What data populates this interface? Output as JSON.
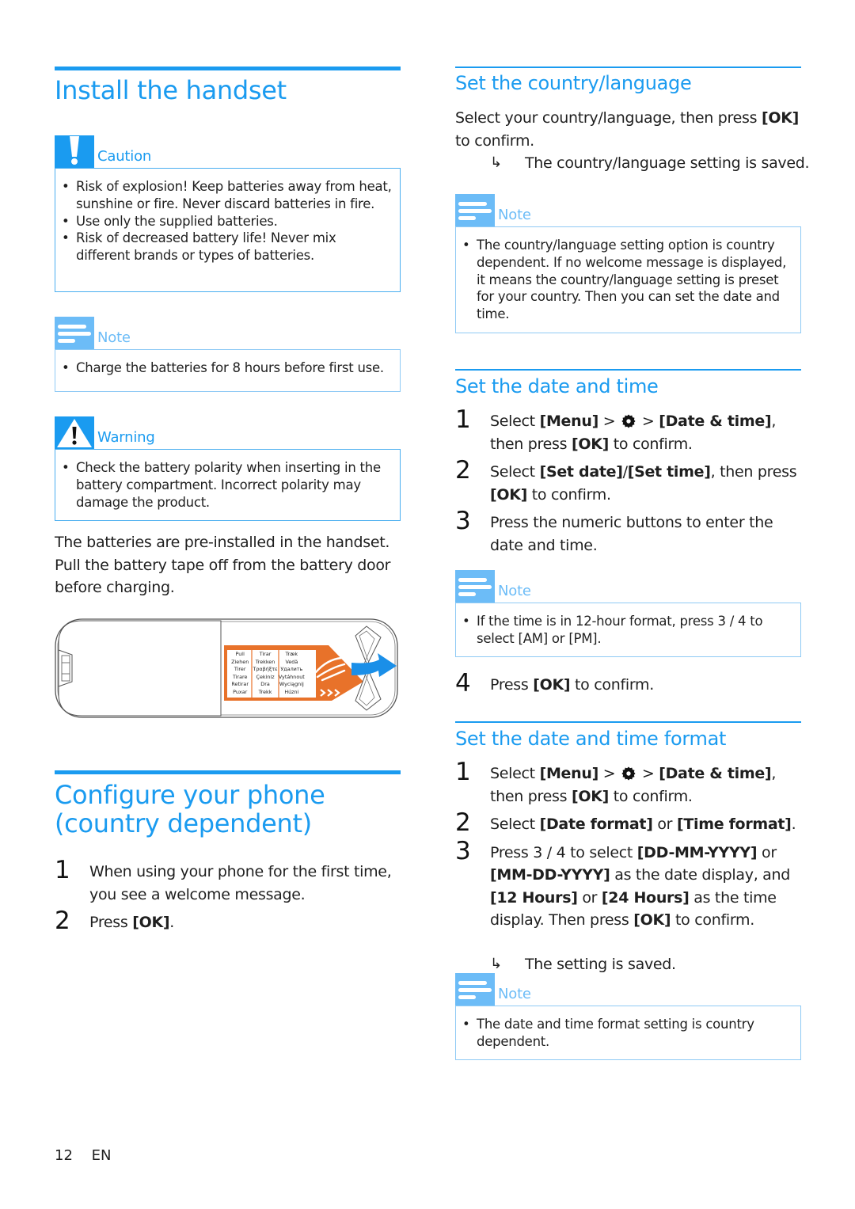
{
  "left": {
    "install": {
      "title": "Install the handset",
      "caution": {
        "label": "Caution",
        "icon": "exclamation-icon",
        "items": [
          "Risk of explosion! Keep batteries away from heat, sunshine or fire. Never discard batteries in fire.",
          "Use only the supplied batteries.",
          "Risk of decreased battery life! Never mix different brands or types of batteries."
        ]
      },
      "note": {
        "label": "Note",
        "icon": "note-lines-icon",
        "items": [
          "Charge the batteries for 8 hours before first use."
        ]
      },
      "warning": {
        "label": "Warning",
        "icon": "warning-triangle-icon",
        "items": [
          "Check the battery polarity when inserting in the battery compartment. Incorrect polarity may damage the product."
        ]
      },
      "paragraph": "The batteries are pre-installed in the handset. Pull the battery tape off from the battery door before charging.",
      "illustration": {
        "tape_columns": [
          [
            "Pull",
            "Ziehen",
            "Tirer",
            "Tirare",
            "Retirar",
            "Puxar"
          ],
          [
            "Tirar",
            "Trekken",
            "Τραβήξτε",
            "Çekiniz",
            "Dra",
            "Trekk"
          ],
          [
            "Træk",
            "Vedä",
            "Удалить",
            "Vytáhnout",
            "Wyciągnij",
            "Húzni"
          ]
        ],
        "tape_color": "#e8722a",
        "arrow_color": "#1a8fe8"
      }
    },
    "configure": {
      "title_line1": "Configure your phone",
      "title_line2": "(country dependent)",
      "steps": [
        {
          "num": "1",
          "text": "When using your phone for the first time, you see a welcome message."
        },
        {
          "num": "2",
          "pre": "Press ",
          "bold": "[OK]",
          "post": "."
        }
      ]
    }
  },
  "right": {
    "country": {
      "title": "Set the country/language",
      "text_pre": "Select your country/language, then press ",
      "text_bold": "[OK]",
      "text_post": " to confirm.",
      "result": "The country/language setting is saved.",
      "note": {
        "label": "Note",
        "items": [
          "The country/language setting option is country dependent. If no welcome message is displayed, it means the country/language setting is preset for your country. Then you can set the date and time."
        ]
      }
    },
    "datetime": {
      "title": "Set the date and time",
      "step1": {
        "num": "1",
        "a": "Select ",
        "b1": "[Menu]",
        "c": " > ",
        "d": " > ",
        "b2": "[Date & time]",
        "e": ", then press ",
        "b3": "[OK]",
        "f": " to confirm."
      },
      "step2": {
        "num": "2",
        "a": "Select ",
        "b1": "[Set date]",
        "c": "/",
        "b2": "[Set time]",
        "d": ", then press ",
        "b3": "[OK]",
        "e": " to confirm."
      },
      "step3": {
        "num": "3",
        "text": "Press the numeric buttons to enter the date and time."
      },
      "note": {
        "label": "Note",
        "a": "If the time is in 12-hour format, press ",
        "keys": "3 /  4",
        "b": " to select ",
        "b1": "[AM]",
        "c": " or ",
        "b2": "[PM]",
        "d": "."
      },
      "step4": {
        "num": "4",
        "a": "Press ",
        "b1": "[OK]",
        "c": " to confirm."
      }
    },
    "format": {
      "title": "Set the date and time format",
      "step1": {
        "num": "1",
        "a": "Select ",
        "b1": "[Menu]",
        "c": " > ",
        "d": " > ",
        "b2": "[Date & time]",
        "e": ", then press ",
        "b3": "[OK]",
        "f": " to confirm."
      },
      "step2": {
        "num": "2",
        "a": "Select ",
        "b1": "[Date format]",
        "c": " or ",
        "b2": "[Time format]",
        "d": "."
      },
      "step3": {
        "num": "3",
        "a": "Press ",
        "keys": "3 /  4",
        "b": " to select ",
        "b1": "[DD-MM-YYYY]",
        "c": " or ",
        "b2": "[MM-DD-YYYY]",
        "d": " as the date display, and ",
        "b3": "[12 Hours]",
        "e": " or ",
        "b4": "[24 Hours]",
        "f": " as the time display. Then press ",
        "b5": "[OK]",
        "g": " to confirm."
      },
      "result": "The setting is saved.",
      "note": {
        "label": "Note",
        "items": [
          "The date and time format setting is country dependent."
        ]
      }
    }
  },
  "footer": {
    "page": "12",
    "lang": "EN"
  },
  "colors": {
    "accent": "#1a9bf0",
    "note_accent": "#6cbcf7",
    "box_border": "#8fcaf5"
  }
}
